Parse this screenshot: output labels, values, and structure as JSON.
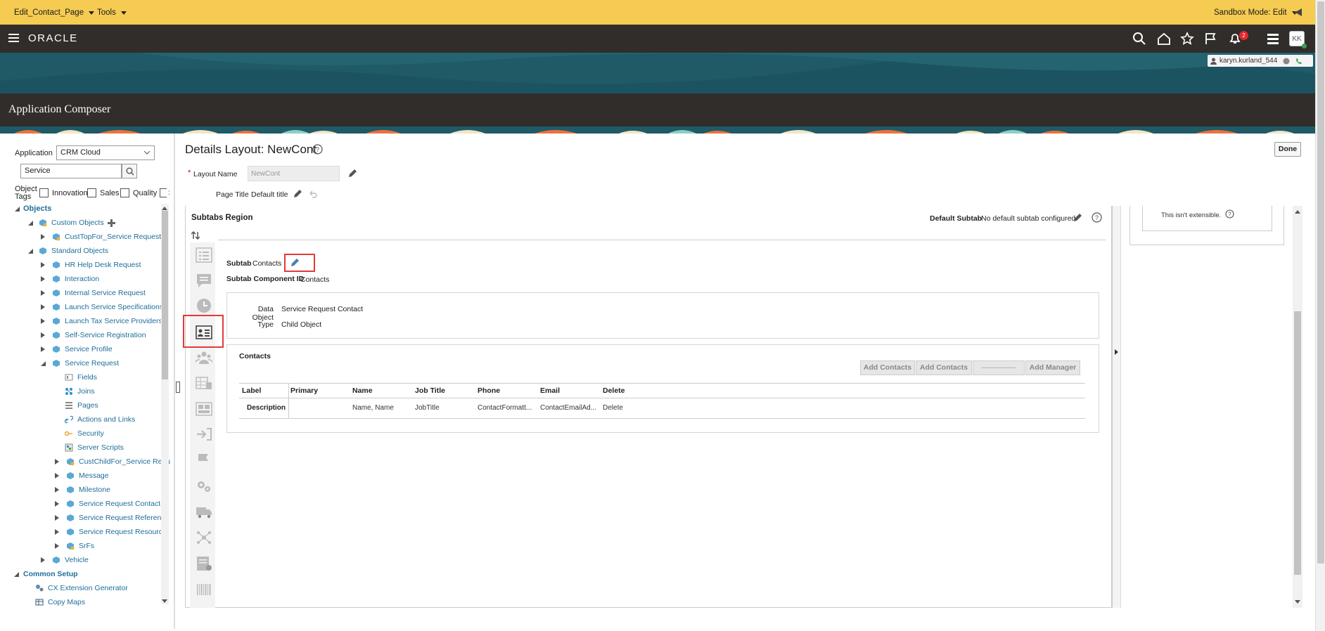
{
  "sandbox_bar": {
    "page_menu": "Edit_Contact_Page",
    "tools_menu": "Tools",
    "sandbox_mode": "Sandbox Mode: Edit"
  },
  "header": {
    "brand": "ORACLE",
    "notification_count": "2",
    "avatar_initials": "KK",
    "user_chip": "karyn.kurland_544"
  },
  "app_title": "Application Composer",
  "navigator": {
    "application_label": "Application",
    "application_value": "CRM Cloud",
    "search_value": "Service",
    "object_tags_label": "Object Tags",
    "tags": [
      "Innovation",
      "Sales",
      "Quality"
    ],
    "objects_label": "Objects",
    "custom_objects": "Custom Objects",
    "custom_child": "CustTopFor_Service Request",
    "standard_objects": "Standard Objects",
    "standard_items": [
      "HR Help Desk Request",
      "Interaction",
      "Internal Service Request",
      "Launch Service Specifications",
      "Launch Tax Service Providers",
      "Self-Service Registration",
      "Service Profile",
      "Service Request"
    ],
    "service_request_children": [
      "Fields",
      "Joins",
      "Pages",
      "Actions and Links",
      "Security",
      "Server Scripts",
      "CustChildFor_Service Requ",
      "Message",
      "Milestone",
      "Service Request Contact",
      "Service Request Reference",
      "Service Request Resource",
      "SrFs"
    ],
    "vehicle": "Vehicle",
    "common_setup": "Common Setup",
    "common_items": [
      "CX Extension Generator",
      "Copy Maps"
    ]
  },
  "main": {
    "title": "Details Layout: NewCont",
    "done_label": "Done",
    "layout_name_label": "Layout Name",
    "layout_name_value": "NewCont",
    "page_title_label": "Page Title",
    "page_title_value": "Default title",
    "subtabs_region_label": "Subtabs Region",
    "default_subtab_label": "Default Subtab",
    "default_subtab_value": "No default subtab configured",
    "subtab_label": "Subtab",
    "subtab_value": "Contacts",
    "component_id_label": "Subtab Component ID",
    "component_id_value": "Contacts",
    "data_object_label": "Data Object",
    "data_object_value": "Service Request Contact",
    "type_label": "Type",
    "type_value": "Child Object",
    "contacts_title": "Contacts",
    "buttons": [
      "Add Contacts",
      "Add Contacts",
      "----------------",
      "Add Manager"
    ],
    "table_headers": [
      "Label",
      "Primary",
      "Name",
      "Job Title",
      "Phone",
      "Email",
      "Delete"
    ],
    "table_row": [
      "Description",
      "",
      "Name, Name",
      "JobTitle",
      "ContactFormatt...",
      "ContactEmailAd...",
      "Delete"
    ]
  },
  "right_panel": {
    "note": "This isn't extensible."
  }
}
